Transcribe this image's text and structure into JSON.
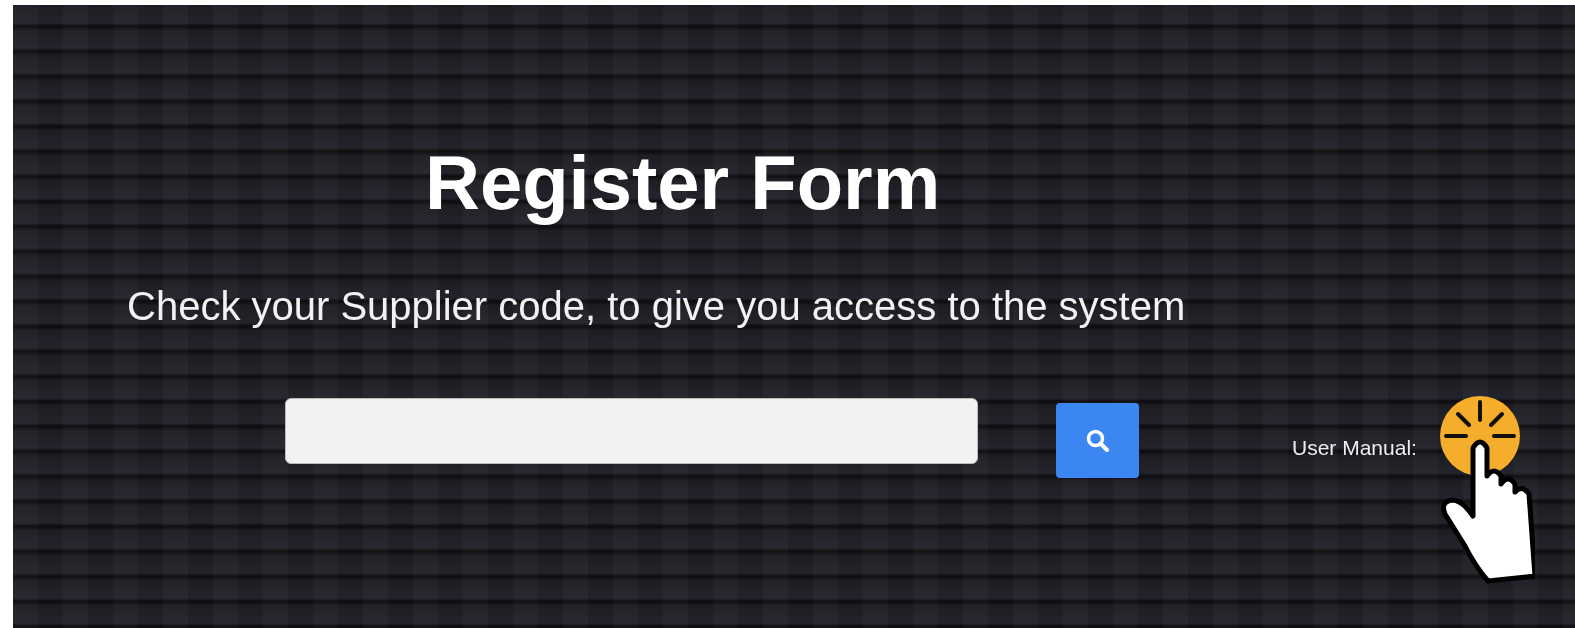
{
  "title": "Register Form",
  "subtitle": "Check your Supplier code, to give you access to the system",
  "user_manual": {
    "label": "User Manual:"
  }
}
